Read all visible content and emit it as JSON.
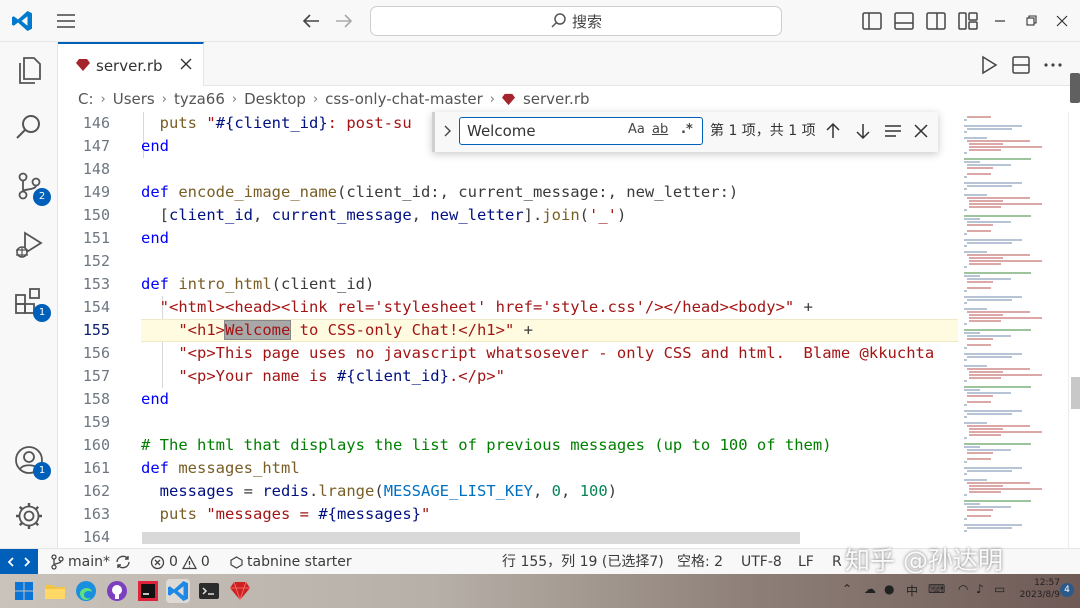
{
  "titlebar": {
    "search_text": "搜索",
    "icons": [
      "vscode-logo-icon",
      "menu-icon",
      "back-arrow-icon",
      "forward-arrow-icon",
      "search-icon",
      "toggle-primary-sidebar-icon",
      "toggle-panel-icon",
      "toggle-secondary-sidebar-icon",
      "customize-layout-icon",
      "minimize-icon",
      "restore-icon",
      "close-icon"
    ]
  },
  "activity_bar": {
    "items": [
      {
        "name": "explorer",
        "icon": "files-icon"
      },
      {
        "name": "search",
        "icon": "search-icon"
      },
      {
        "name": "source-control",
        "icon": "source-control-icon",
        "badge": "2"
      },
      {
        "name": "run-debug",
        "icon": "run-debug-icon"
      },
      {
        "name": "extensions",
        "icon": "extensions-icon",
        "badge": "1"
      },
      {
        "name": "accounts",
        "icon": "account-icon",
        "badge": "1"
      },
      {
        "name": "manage",
        "icon": "gear-icon"
      }
    ],
    "accent": "#005fb8"
  },
  "tabs": [
    {
      "label": "server.rb",
      "active": true,
      "icon": "ruby-file-icon"
    }
  ],
  "breadcrumb": [
    "C:",
    "Users",
    "tyza66",
    "Desktop",
    "css-only-chat-master",
    "server.rb"
  ],
  "find_widget": {
    "value": "Welcome",
    "options": [
      "Aa",
      "ab",
      ".*"
    ],
    "count": "第 1 项，共 1 项"
  },
  "editor": {
    "active_line": "155",
    "lines": [
      {
        "n": "146",
        "t": "    puts \"#{client_id}: post-su"
      },
      {
        "n": "147",
        "t": "  end"
      },
      {
        "n": "148",
        "t": ""
      },
      {
        "n": "149",
        "t": "  def encode_image_name(client_id:, current_message:, new_letter:)"
      },
      {
        "n": "150",
        "t": "    [client_id, current_message, new_letter].join('_')"
      },
      {
        "n": "151",
        "t": "  end"
      },
      {
        "n": "152",
        "t": ""
      },
      {
        "n": "153",
        "t": "  def intro_html(client_id)"
      },
      {
        "n": "154",
        "t": "    \"<html><head><link rel='stylesheet' href='style.css'/></head><body>\" +"
      },
      {
        "n": "155",
        "t": "      \"<h1>Welcome to CSS-only Chat!</h1>\" +"
      },
      {
        "n": "156",
        "t": "      \"<p>This page uses no javascript whatsosever - only CSS and html.  Blame @kkuchta"
      },
      {
        "n": "157",
        "t": "      \"<p>Your name is #{client_id}.</p>\""
      },
      {
        "n": "158",
        "t": "  end"
      },
      {
        "n": "159",
        "t": ""
      },
      {
        "n": "160",
        "t": "  # The html that displays the list of previous messages (up to 100 of them)"
      },
      {
        "n": "161",
        "t": "  def messages_html"
      },
      {
        "n": "162",
        "t": "    messages = redis.lrange(MESSAGE_LIST_KEY, 0, 100)"
      },
      {
        "n": "163",
        "t": "    puts \"messages = #{messages}\""
      },
      {
        "n": "164",
        "t": ""
      }
    ],
    "syntax_colors": {
      "keyword": "#0000ff",
      "string": "#a31515",
      "comment": "#008000",
      "function": "#795e26",
      "constant": "#0070c1",
      "number": "#098658"
    }
  },
  "statusbar": {
    "branch": "main*",
    "errors": "0",
    "warnings": "0",
    "tabnine": "tabnine starter",
    "cursor": "行 155，列 19 (已选择7)",
    "indent": "空格: 2",
    "encoding": "UTF-8",
    "eol": "LF",
    "language": "R"
  },
  "watermark": "知乎 @孙达明",
  "taskbar": {
    "apps": [
      "windows-start-icon",
      "file-explorer-icon",
      "edge-browser-icon",
      "github-desktop-icon",
      "jetbrains-icon",
      "vscode-icon",
      "terminal-icon",
      "ruby-gem-icon"
    ],
    "tray_lang": "中",
    "time": "12:57",
    "date": "2023/8/9",
    "notifications": "4"
  }
}
